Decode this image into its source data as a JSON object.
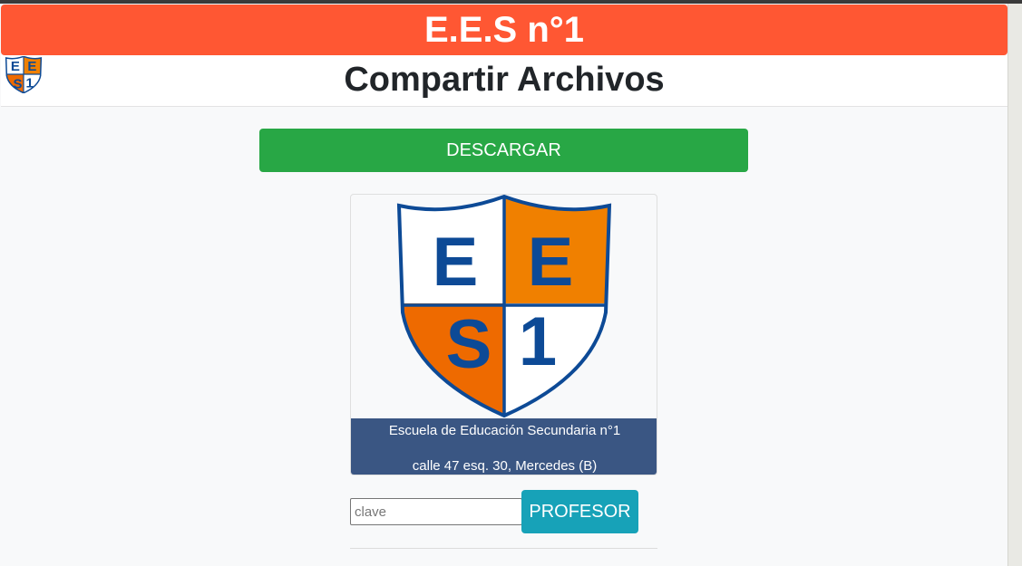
{
  "header": {
    "banner_title": "E.E.S n°1",
    "page_title": "Compartir Archivos"
  },
  "logo": {
    "letters": [
      "E",
      "E",
      "S",
      "1"
    ]
  },
  "actions": {
    "download_label": "DESCARGAR",
    "professor_label": "PROFESOR"
  },
  "school_card": {
    "name": "Escuela de Educación Secundaria n°1",
    "address": "calle 47 esq. 30, Mercedes (B)"
  },
  "form": {
    "password_placeholder": "clave",
    "password_value": ""
  },
  "colors": {
    "banner": "#ff5733",
    "download": "#28a745",
    "professor": "#17a2b8",
    "card_footer": "#3a5683",
    "shield_blue": "#0d4a96",
    "shield_orange": "#f08000"
  }
}
